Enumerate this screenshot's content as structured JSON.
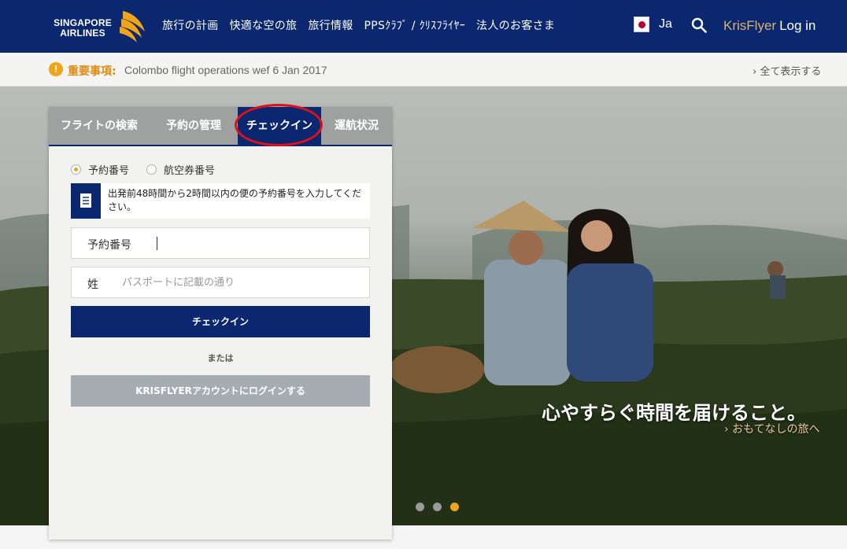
{
  "header": {
    "logo_line1": "SINGAPORE",
    "logo_line2": "AIRLINES",
    "nav": [
      "旅行の計画",
      "快適な空の旅",
      "旅行情報",
      "PPSｸﾗﾌﾞ / ｸﾘｽﾌﾗｲﾔｰ",
      "法人のお客さま"
    ],
    "language": "Ja",
    "krisflyer": "KrisFlyer",
    "login": "Log in",
    "search_icon": "search-icon"
  },
  "alert": {
    "icon": "!",
    "label": "重要事項:",
    "text": "Colombo flight operations wef 6 Jan 2017",
    "view_all": "› 全て表示する"
  },
  "widget": {
    "tabs": [
      {
        "label": "フライトの検索"
      },
      {
        "label": "予約の管理"
      },
      {
        "label": "チェックイン"
      },
      {
        "label": "運航状況"
      }
    ],
    "active_tab": "チェックイン",
    "radio_options": [
      {
        "label": "予約番号",
        "checked": true
      },
      {
        "label": "航空券番号",
        "checked": false
      }
    ],
    "info": "出発前48時間から2時間以内の便の予約番号を入力してください。",
    "booking_label": "予約番号",
    "booking_value": "",
    "surname_label": "姓",
    "surname_placeholder": "パスポートに記載の通り",
    "checkin_button": "チェックイン",
    "or_text": "または",
    "krisflyer_button": "KRISFLYERアカウントにログインする"
  },
  "hero": {
    "tagline": "心やすらぐ時間を届けること。",
    "link": "› おもてなしの旅へ",
    "carousel_active": 3,
    "carousel_count": 3
  },
  "colors": {
    "brand_navy": "#0a2770",
    "accent_gold": "#f0a419",
    "krisflyer_gold": "#d9b46e",
    "highlight_ring": "#e0101a"
  }
}
